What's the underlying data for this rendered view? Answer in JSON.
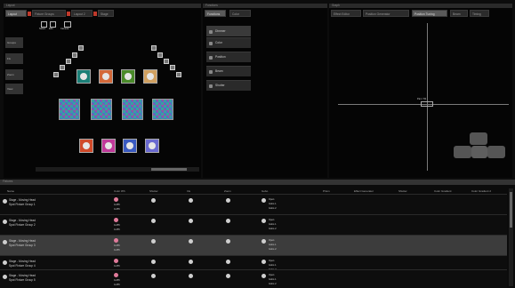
{
  "panels": {
    "layout_title": "Layout",
    "functions_title": "Functions",
    "graph_title": "Graph",
    "fixtures_title": "Fixtures"
  },
  "layout_tabs": [
    "Layout",
    "Fixture Groups",
    "Layout 2",
    "Stage"
  ],
  "layout_side": [
    "Groups",
    "Fix",
    "Zoom",
    "View"
  ],
  "layout_toolbar": [
    "Select",
    "Edit",
    "Camera"
  ],
  "functions_tabs": [
    "Functions",
    "Color"
  ],
  "functions_items": [
    "Dimmer",
    "Color",
    "Position",
    "Beam",
    "Shutter"
  ],
  "graph_tabs": [
    "Effect Editor",
    "Position Generator",
    "Position Tuning",
    "Beam",
    "Timing"
  ],
  "graph_center_label": "Pan / Tilt",
  "table_headers": [
    "Name",
    "Color Wh",
    "Shutter",
    "Iris",
    "Zoom",
    "Gobo",
    "Prism",
    "Effect Generator",
    "Shutter",
    "Color Gradient",
    "Color Gradient 2"
  ],
  "rows": [
    {
      "name": "Stage - Moving Head",
      "sub": "Spot Fixture Group 1",
      "vals": [
        "0-255",
        "0-255"
      ],
      "gobo": [
        "Open",
        "Gobo 1",
        "Gobo 2"
      ]
    },
    {
      "name": "Stage - Moving Head",
      "sub": "Spot Fixture Group 2",
      "vals": [
        "0-255",
        "0-255"
      ],
      "gobo": [
        "Open",
        "Gobo 1",
        "Gobo 2"
      ]
    },
    {
      "name": "Stage - Moving Head",
      "sub": "Spot Fixture Group 3",
      "vals": [
        "0-255",
        "0-255"
      ],
      "gobo": [
        "Open",
        "Gobo 1",
        "Gobo 2"
      ]
    },
    {
      "name": "Stage - Moving Head",
      "sub": "Spot Fixture Group 4",
      "vals": [
        "0-255",
        "0-255"
      ],
      "gobo": [
        "Open",
        "Gobo 1",
        "Gobo 2"
      ]
    },
    {
      "name": "Stage - Moving Head",
      "sub": "Spot Fixture Group 5",
      "vals": [
        "0-255",
        "0-255"
      ],
      "gobo": [
        "Open",
        "Gobo 1",
        "Gobo 2"
      ]
    }
  ],
  "colors": {
    "accent_red": "#c0392b",
    "row_highlight": "#3c3c3c"
  }
}
